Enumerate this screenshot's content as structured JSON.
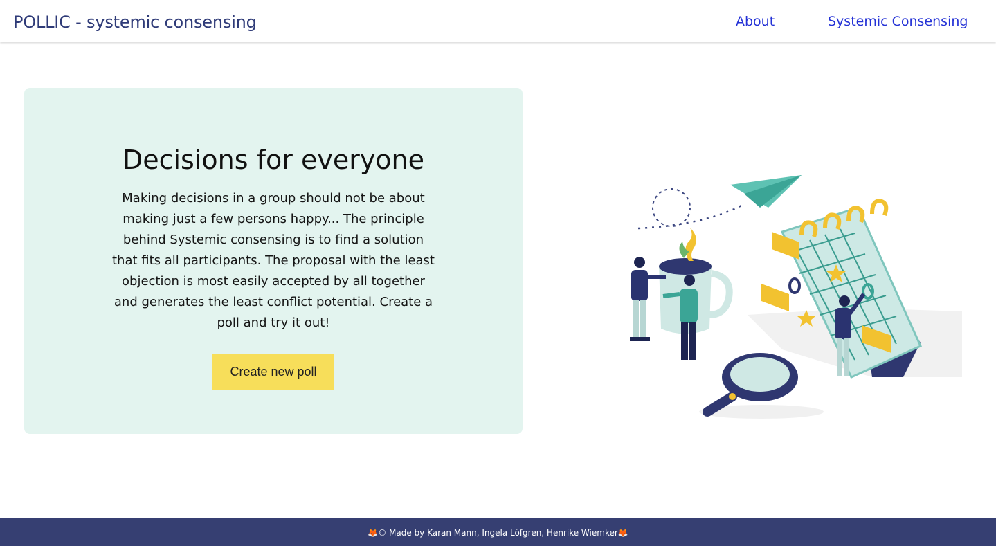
{
  "header": {
    "brand": "POLLIC - systemic consensing",
    "nav": {
      "about": "About",
      "systemic": "Systemic Consensing"
    }
  },
  "hero": {
    "title": "Decisions for everyone",
    "text": "Making decisions in a group should not be about making just a few persons happy... The principle behind Systemic consensing is to find a solution that fits all participants. The proposal with the least objection is most easily accepted by all together and generates the least conflict potential. Create a poll and try it out!",
    "button": "Create new poll"
  },
  "illustration": {
    "icon": "people-calendar-illustration"
  },
  "footer": {
    "text": "🦊© Made by Karan Mann, Ingela Löfgren, Henrike Wiemker🦊"
  },
  "colors": {
    "brand": "#2f3b78",
    "nav_link": "#2432d6",
    "card_bg": "#e3f4ef",
    "button_bg": "#f7de5a",
    "footer_bg": "#363f72"
  }
}
